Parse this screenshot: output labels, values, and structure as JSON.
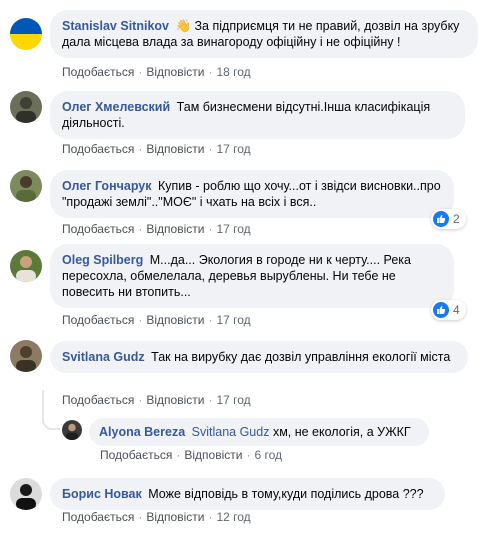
{
  "actions": {
    "like": "Подобається",
    "reply": "Відповісти",
    "dot": "·"
  },
  "comments": [
    {
      "author": "Stanislav Sitnikov",
      "text": "👋 За підприємця ти не правий, дозвіл на зрубку дала місцева влада за винагороду офіційну і не офіційну !",
      "time": "18 год",
      "avatar": "ukraine-flag-avatar"
    },
    {
      "author": "Олег Хмелевский",
      "text": "Там бизнесмени відсутні.Інша класифікація діяльності.",
      "time": "17 год",
      "avatar": "user-photo-avatar"
    },
    {
      "author": "Олег Гончарук",
      "text": "Купив - роблю що хочу...от і звідси висновки..про \"продажі землі\"..\"МОЄ\" і чхать на всіх і вся..",
      "time": "17 год",
      "reactions": "2",
      "avatar": "user-photo-avatar"
    },
    {
      "author": "Oleg Spilberg",
      "text": "М...да... Экология в городе ни к черту.... Река пересохла, обмелелала, деревья вырублены. Ни тебе не повесить ни втопить...",
      "time": "17 год",
      "reactions": "4",
      "avatar": "user-photo-avatar"
    },
    {
      "author": "Svitlana Gudz",
      "text": "Так на вирубку дає дозвіл управління екології міста",
      "time": "17 год",
      "avatar": "user-photo-avatar"
    },
    {
      "author": "Alyona Bereza",
      "mention": "Svitlana Gudz",
      "text": " хм, не екологія, а УЖКГ",
      "time": "6 год",
      "avatar": "user-photo-avatar"
    },
    {
      "author": "Борис Новак",
      "text": "Може відповідь в тому,куди поділись дрова ???",
      "time": "12 год",
      "avatar": "user-photo-avatar"
    }
  ],
  "colors": {
    "author": "#385898",
    "bubble": "#f0f2f5",
    "like": "#1877f2",
    "flag_blue": "#0057b7",
    "flag_yellow": "#ffd700"
  }
}
